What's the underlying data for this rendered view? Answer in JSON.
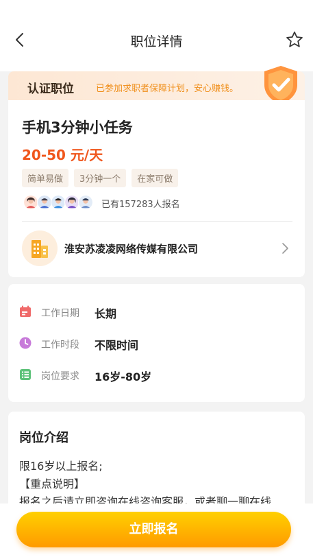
{
  "header": {
    "title": "职位详情"
  },
  "certified": {
    "title": "认证职位",
    "desc": "已参加求职者保障计划，安心赚钱。"
  },
  "job": {
    "title": "手机3分钟小任务",
    "salary": "20-50 元/天",
    "tags": [
      "简单易做",
      "3分钟一个",
      "在家可做"
    ],
    "signup_count": "已有157283人报名"
  },
  "company": {
    "name": "淮安苏凌凌网络传媒有限公司"
  },
  "info": [
    {
      "label": "工作日期",
      "value": "长期",
      "icon": "calendar-icon",
      "color": "#f06a6a"
    },
    {
      "label": "工作时段",
      "value": "不限时间",
      "icon": "clock-icon",
      "color": "#c77ad9"
    },
    {
      "label": "岗位要求",
      "value": "16岁-80岁",
      "icon": "checklist-icon",
      "color": "#5ec27a"
    }
  ],
  "description": {
    "title": "岗位介绍",
    "lines": [
      "限16岁以上报名;",
      "【重点说明】",
      "报名之后请立即咨询在线咨询客服，或者聊一聊在线"
    ]
  },
  "footer": {
    "apply_label": "立即报名"
  },
  "colors": {
    "accent": "#ff9a00",
    "salary": "#f0561c",
    "banner_text": "#f0901d"
  }
}
